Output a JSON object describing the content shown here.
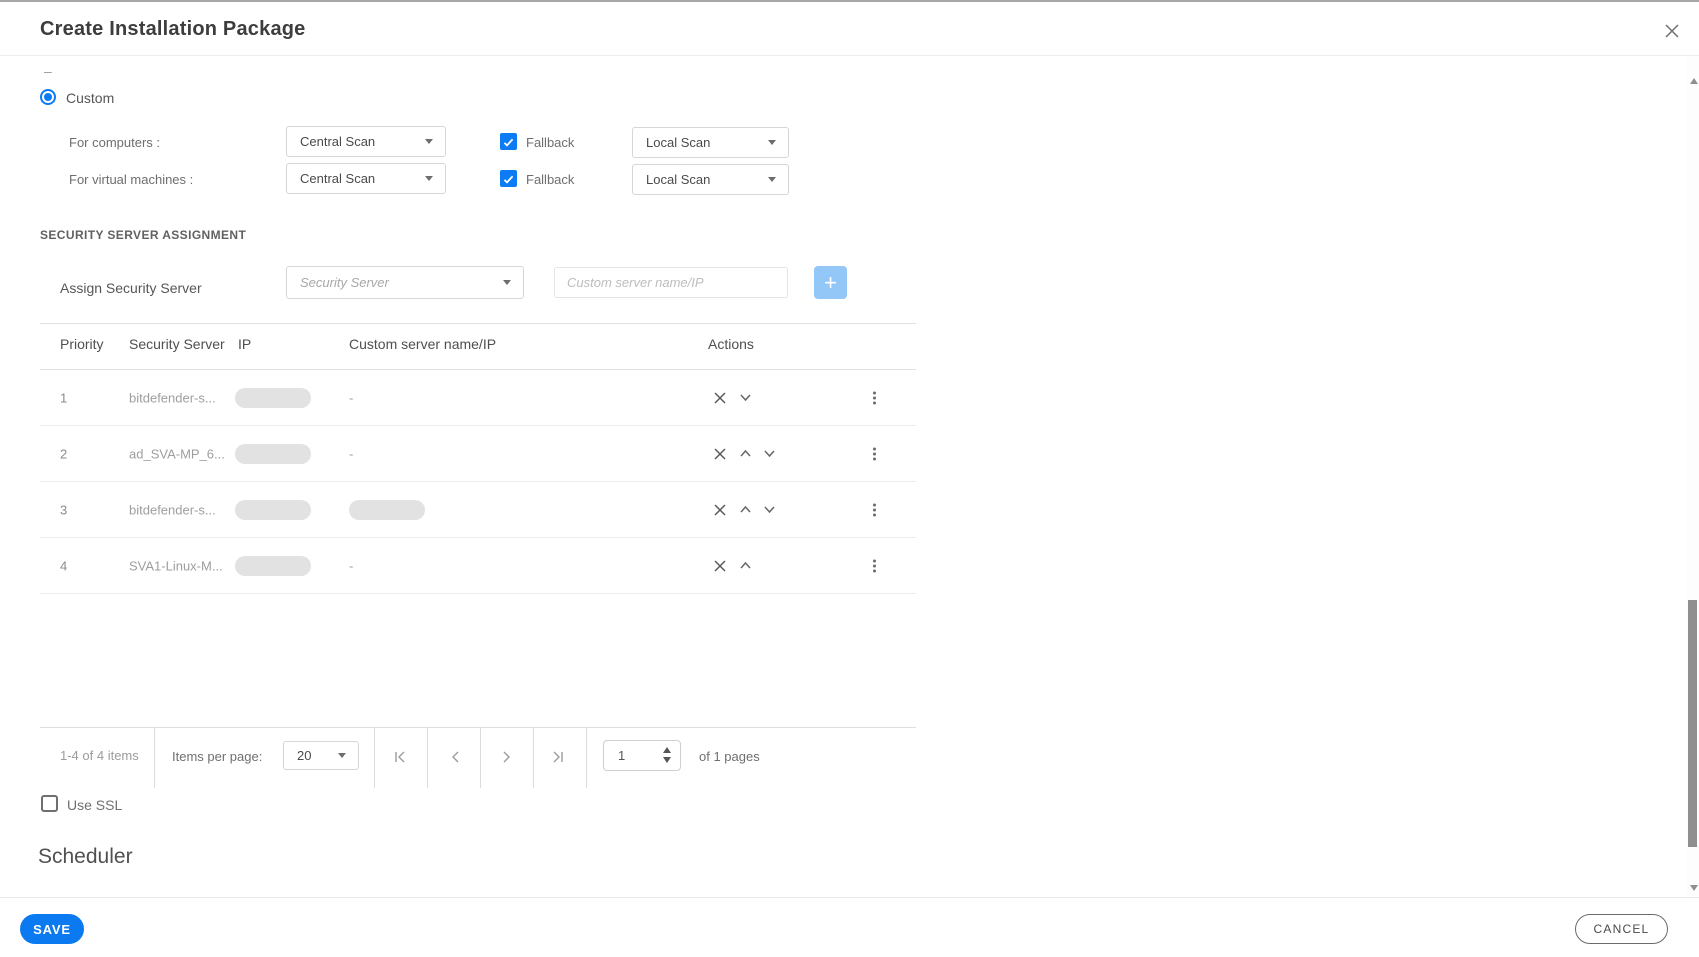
{
  "dialog": {
    "title": "Create Installation Package"
  },
  "scan_mode": {
    "truncated_remnant": "–",
    "custom_label": "Custom",
    "rows": [
      {
        "label": "For computers :",
        "primary_value": "Central Scan",
        "fallback_label": "Fallback",
        "fallback_checked": true,
        "secondary_value": "Local Scan"
      },
      {
        "label": "For virtual machines :",
        "primary_value": "Central Scan",
        "fallback_label": "Fallback",
        "fallback_checked": true,
        "secondary_value": "Local Scan"
      }
    ]
  },
  "security_server_assignment": {
    "section_title": "SECURITY SERVER ASSIGNMENT",
    "assign_label": "Assign Security Server",
    "server_select_placeholder": "Security Server",
    "custom_input_placeholder": "Custom server name/IP",
    "add_button_label": "+"
  },
  "server_table": {
    "columns": [
      "Priority",
      "Security Server",
      "IP",
      "Custom server name/IP",
      "Actions"
    ],
    "rows": [
      {
        "priority": "1",
        "name": "bitdefender-s...",
        "ip_masked": true,
        "custom": "-",
        "custom_masked": false,
        "actions": [
          "remove",
          "move-down"
        ]
      },
      {
        "priority": "2",
        "name": "ad_SVA-MP_6...",
        "ip_masked": true,
        "custom": "-",
        "custom_masked": false,
        "actions": [
          "remove",
          "move-up",
          "move-down"
        ]
      },
      {
        "priority": "3",
        "name": "bitdefender-s...",
        "ip_masked": true,
        "custom": "",
        "custom_masked": true,
        "actions": [
          "remove",
          "move-up",
          "move-down"
        ]
      },
      {
        "priority": "4",
        "name": "SVA1-Linux-M...",
        "ip_masked": true,
        "custom": "-",
        "custom_masked": false,
        "actions": [
          "remove",
          "move-up"
        ]
      }
    ]
  },
  "pagination": {
    "range_text": "1-4 of 4 items",
    "items_per_page_label": "Items per page:",
    "items_per_page_value": "20",
    "page_value": "1",
    "pages_text": "of 1 pages"
  },
  "use_ssl": {
    "label": "Use SSL",
    "checked": false
  },
  "scheduler_heading": "Scheduler",
  "footer": {
    "save_label": "SAVE",
    "cancel_label": "CANCEL"
  },
  "icons": {
    "close": "x-mark",
    "dropdown": "caret-down",
    "remove_row": "x-mark",
    "move_up": "chevron-up",
    "move_down": "chevron-down",
    "row_menu": "kebab-vertical-dots",
    "first_page": "bar-chevron-left",
    "prev_page": "chevron-left",
    "next_page": "chevron-right",
    "last_page": "chevron-right-bar"
  },
  "colors": {
    "accent_blue": "#0b7af0",
    "add_button_blue": "#93c7f8",
    "masked_pill_gray": "#e2e2e2"
  }
}
